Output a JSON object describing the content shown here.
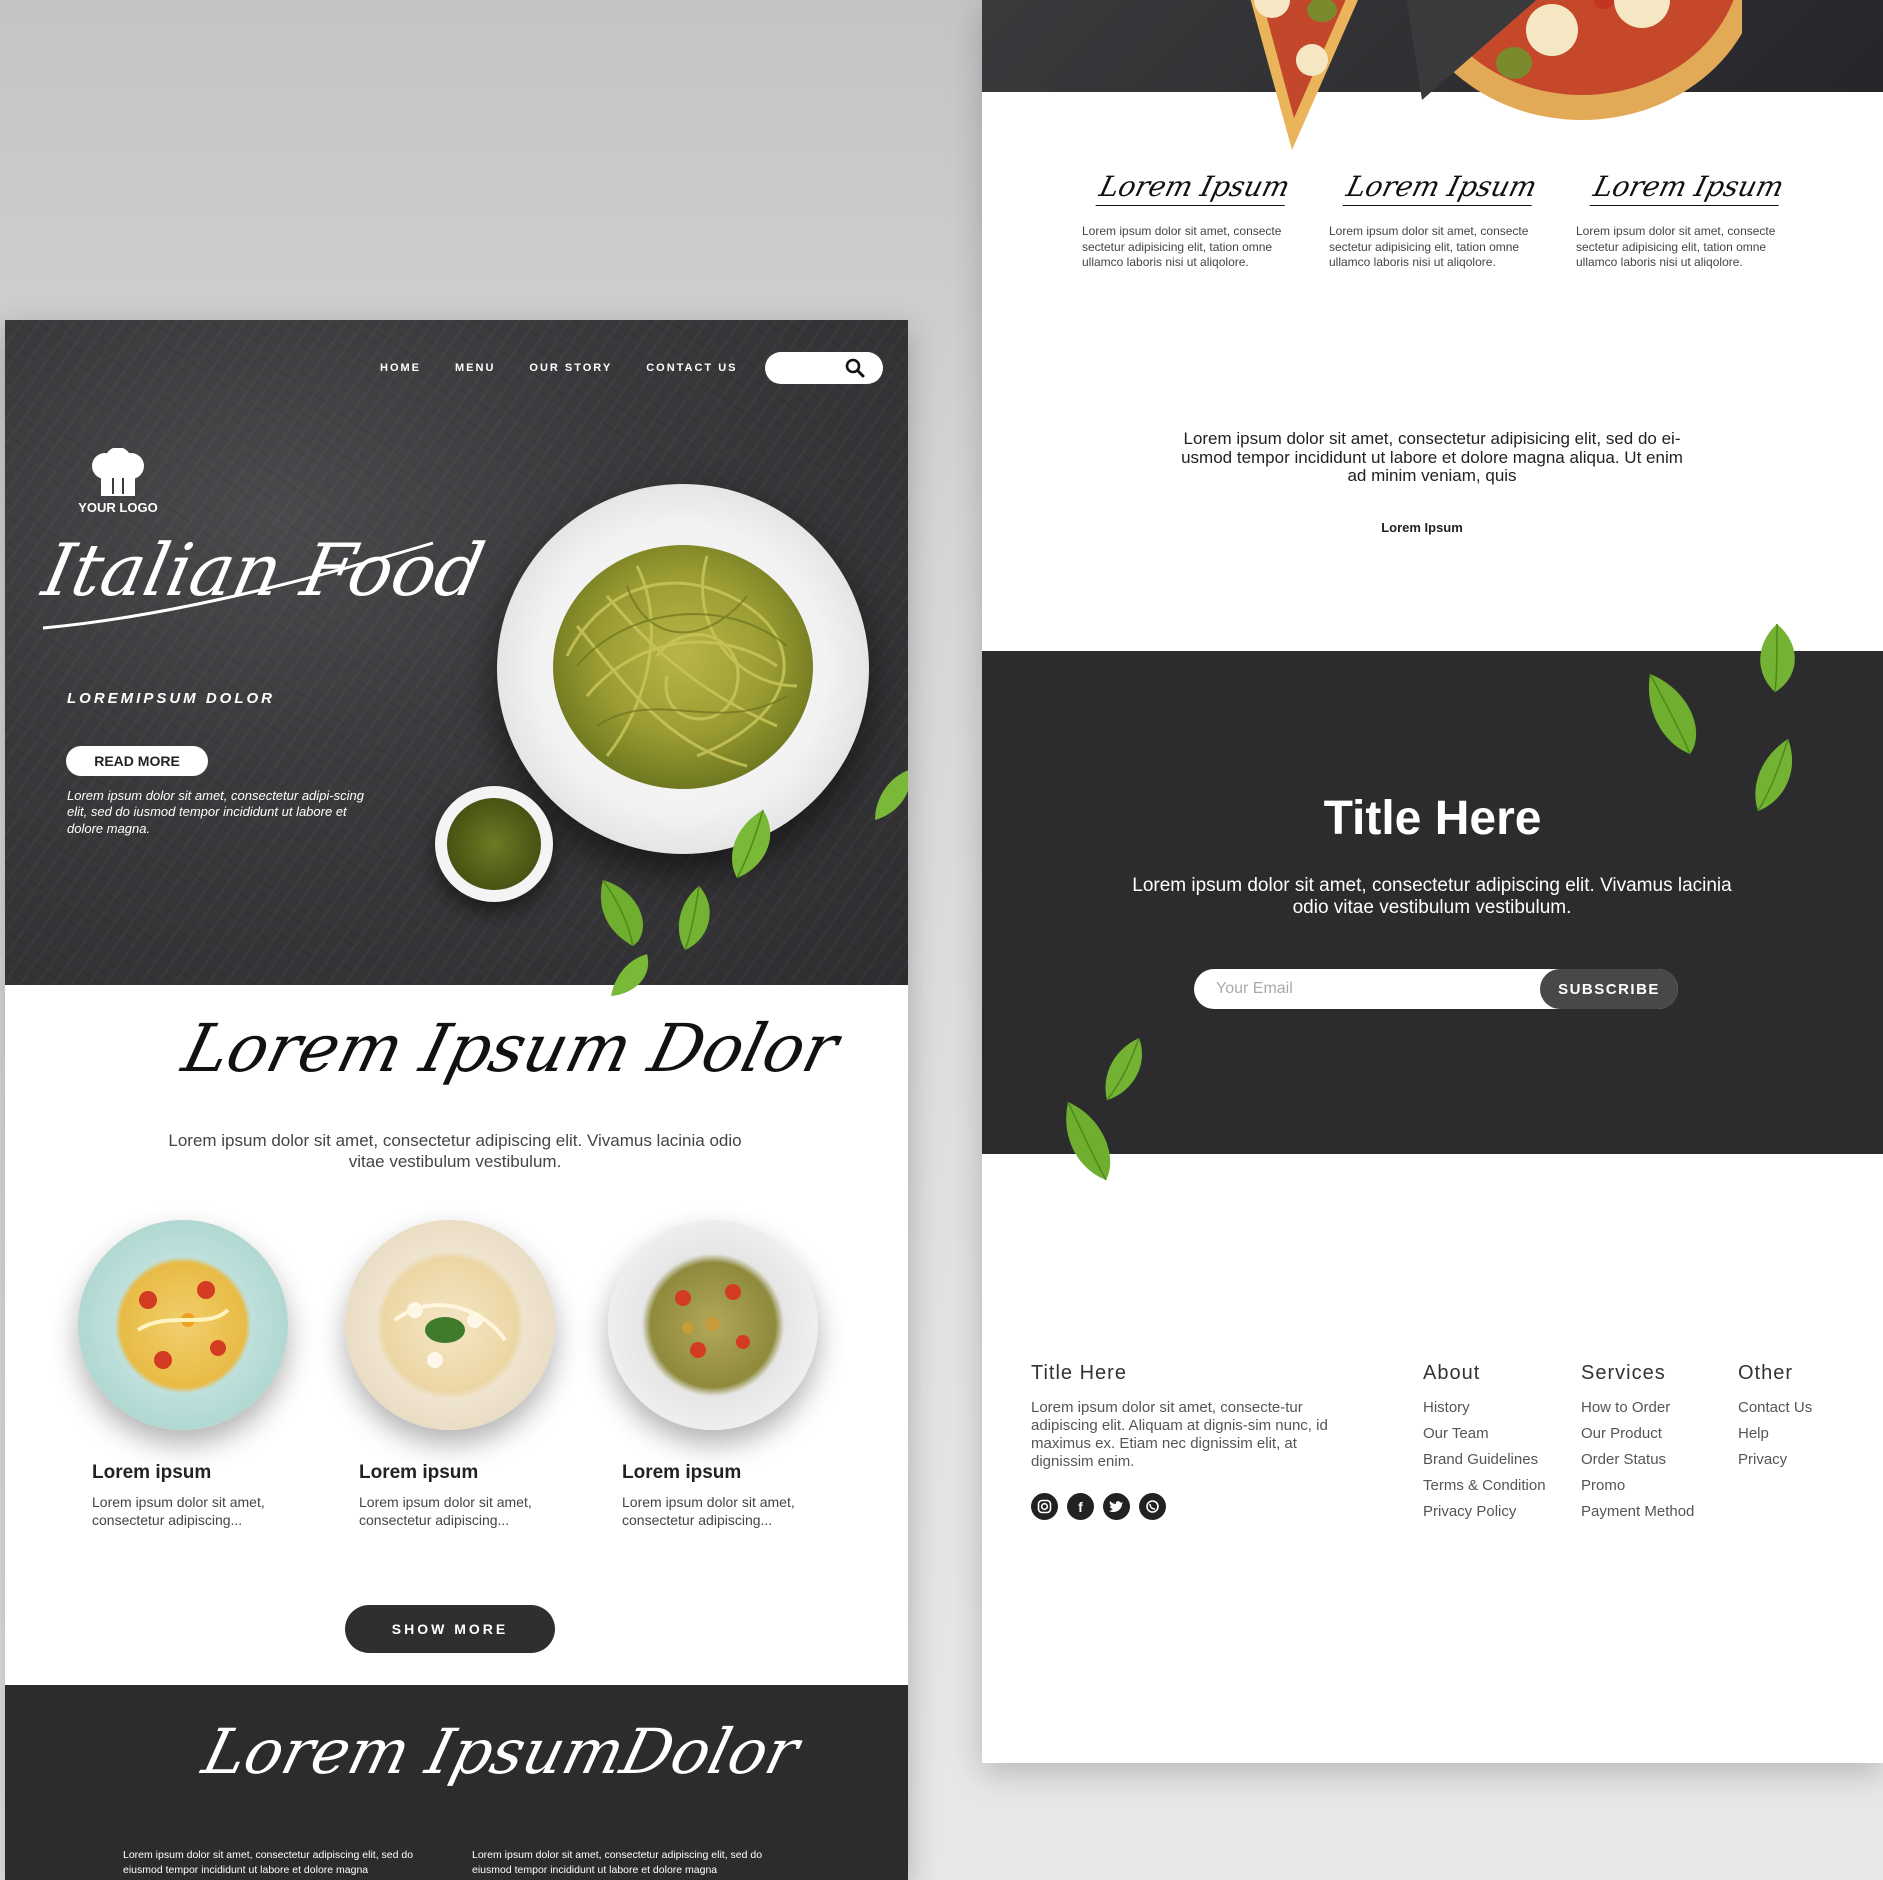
{
  "left_page": {
    "nav": [
      {
        "label": "HOME"
      },
      {
        "label": "MENU"
      },
      {
        "label": "OUR STORY"
      },
      {
        "label": "CONTACT US"
      }
    ],
    "logo_text": "YOUR LOGO",
    "hero": {
      "title": "Italian Food",
      "subtitle": "LOREMIPSUM DOLOR",
      "read_more": "READ MORE",
      "description": "Lorem ipsum dolor sit amet, consectetur adipi-scing elit, sed do iusmod tempor incididunt ut labore et dolore magna."
    },
    "section": {
      "title": "Lorem Ipsum Dolor",
      "description": "Lorem ipsum dolor sit amet, consectetur adipiscing elit. Vivamus lacinia odio vitae vestibulum vestibulum."
    },
    "dishes": [
      {
        "name": "Lorem ipsum",
        "desc": "Lorem ipsum dolor sit amet, consectetur  adipiscing..."
      },
      {
        "name": "Lorem ipsum",
        "desc": "Lorem ipsum dolor sit amet, consectetur  adipiscing..."
      },
      {
        "name": "Lorem ipsum",
        "desc": "Lorem ipsum dolor sit amet, consectetur  adipiscing..."
      }
    ],
    "show_more": "SHOW MORE",
    "bottom": {
      "title": "Lorem IpsumDolor",
      "col1": "Lorem ipsum dolor sit amet, consectetur adipiscing elit, sed do eiusmod tempor incididunt ut labore et dolore magna",
      "col2": "Lorem ipsum dolor sit amet, consectetur adipiscing elit, sed do eiusmod tempor incididunt ut labore et dolore magna"
    }
  },
  "right_page": {
    "features": [
      {
        "title": "Lorem Ipsum",
        "desc": "Lorem ipsum dolor sit amet, consecte sectetur adipisicing elit, tation omne ullamco laboris nisi ut aliqolore."
      },
      {
        "title": "Lorem Ipsum",
        "desc": "Lorem ipsum dolor sit amet, consecte sectetur adipisicing elit, tation omne ullamco laboris nisi ut aliqolore."
      },
      {
        "title": "Lorem Ipsum",
        "desc": "Lorem ipsum dolor sit amet, consecte sectetur adipisicing elit, tation omne ullamco laboris nisi ut aliqolore."
      }
    ],
    "quote": "Lorem ipsum dolor sit amet, consectetur adipisicing elit, sed do ei-usmod tempor incididunt ut labore et dolore magna aliqua. Ut enim ad minim veniam, quis",
    "quote_author": "Lorem Ipsum",
    "newsletter": {
      "title": "Title Here",
      "description": "Lorem ipsum dolor sit amet, consectetur adipiscing elit. Vivamus lacinia odio vitae vestibulum vestibulum.",
      "email_placeholder": "Your Email",
      "subscribe": "SUBSCRIBE"
    },
    "footer": {
      "title": "Title Here",
      "text": "Lorem ipsum dolor sit amet, consecte-tur adipiscing elit. Aliquam at dignis-sim nunc, id maximus ex. Etiam nec dignissim elit, at dignissim enim.",
      "socials": [
        "instagram-icon",
        "facebook-icon",
        "twitter-icon",
        "whatsapp-icon"
      ],
      "about": {
        "heading": "About",
        "links": [
          "History",
          "Our Team",
          "Brand Guidelines",
          "Terms & Condition",
          "Privacy Policy"
        ]
      },
      "services": {
        "heading": "Services",
        "links": [
          "How to Order",
          "Our Product",
          "Order Status",
          "Promo",
          "Payment Method"
        ]
      },
      "other": {
        "heading": "Other",
        "links": [
          "Contact Us",
          "Help",
          "Privacy"
        ]
      }
    }
  },
  "colors": {
    "dark": "#2c2c2e",
    "button_dark": "#4a4846",
    "leaf_green": "#6fae2f",
    "pesto": "#a7a83a"
  }
}
